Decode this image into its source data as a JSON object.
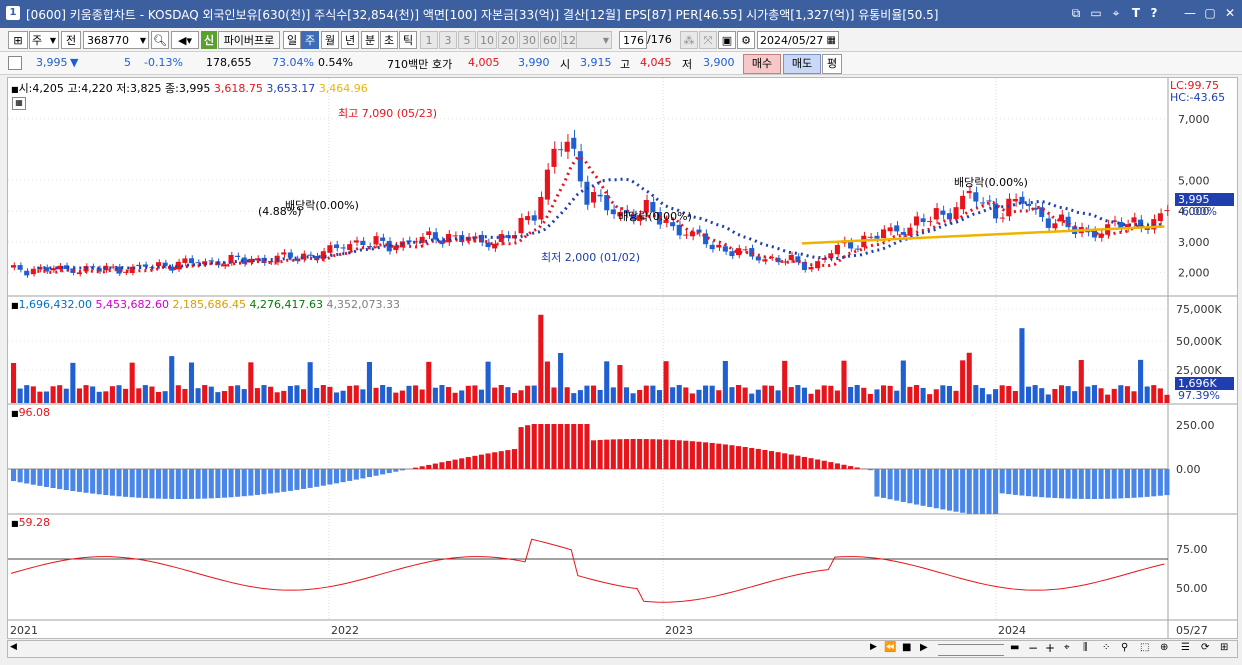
{
  "title_bar": {
    "number": "1",
    "title": "[0600] 키움종합차트 - KOSDAQ 외국인보유[630(천)] 주식수[32,854(천)] 액면[100] 자본금[33(억)] 결산[12월] EPS[87] PER[46.55] 시가총액[1,327(억)] 유통비율[50.5]",
    "controls": [
      "⧉",
      "▭",
      "⌖",
      "T",
      "?",
      "│",
      "—",
      "▢",
      "✕"
    ]
  },
  "toolbar": {
    "period_type": "주",
    "period_scope": "전",
    "stock_code": "368770",
    "indicator_badge": "신",
    "indicator_name": "파이버프로",
    "tabs": [
      "일",
      "주",
      "월",
      "년",
      "분",
      "초",
      "틱"
    ],
    "selected_tab": "주",
    "interval_buttons": [
      "1",
      "3",
      "5",
      "10",
      "20",
      "30",
      "60",
      "120"
    ],
    "count": "176",
    "count_total": "/176",
    "date": "2024/05/27"
  },
  "quote": {
    "price": "3,995",
    "change_arrow": "▼",
    "change": "5",
    "change_pct": "-0.13%",
    "volume": "178,655",
    "vol_ratio": "73.04%",
    "turnover": "0.54%",
    "amount": "710백만",
    "ask_label": "호가",
    "ask": "4,005",
    "bid": "3,990",
    "open_label": "시",
    "open": "3,915",
    "high_label": "고",
    "high": "4,045",
    "low_label": "저",
    "low": "3,900",
    "buy": "매수",
    "sell": "매도",
    "eval": "평"
  },
  "price_panel": {
    "legend_ohlc": "시:4,205 고:4,220 저:3,825 종:3,995",
    "legend_ma1": "3,618.75",
    "legend_ma2": "3,653.17",
    "legend_ma3": "3,464.96",
    "lc": "LC:99.75",
    "hc": "HC:-43.65",
    "y_ticks": [
      "7,000",
      "5,000",
      "4,000",
      "3,000",
      "2,000"
    ],
    "current_price_tag": "3,995",
    "current_pct_tag": "-6.00%",
    "ann_high": "최고 7,090 (05/23)",
    "ann_low": "최저 2,000 (01/02)",
    "ann_div1": "배당락(0.00%)",
    "ann_div1_pct": "(4.88%)",
    "ann_div2": "배당락(0.00%)",
    "ann_div3": "배당락(0.00%)"
  },
  "volume_panel": {
    "legend_values": [
      "1,696,432.00",
      "5,453,682.60",
      "2,185,686.45",
      "4,276,417.63",
      "4,352,073.33"
    ],
    "legend_colors": [
      "#0070c0",
      "#cc00cc",
      "#d4a000",
      "#008000",
      "#808080"
    ],
    "y_ticks": [
      "75,000K",
      "50,000K",
      "25,000K"
    ],
    "current_tag": "1,696K",
    "pct_tag": "97.39%"
  },
  "macd_panel": {
    "legend": "96.08",
    "y_ticks": [
      "250.00",
      "0.00"
    ]
  },
  "rsi_panel": {
    "legend": "59.28",
    "y_ticks": [
      "75.00",
      "50.00"
    ]
  },
  "x_axis": {
    "labels": [
      "2021",
      "2022",
      "2023",
      "2024"
    ],
    "end_label": "05/27"
  },
  "colors": {
    "up": "#e8141c",
    "down": "#1f5fd1",
    "title_bg": "#3c5fa0",
    "ma_yellow": "#f0b400"
  },
  "chart_data": {
    "type": "candlestick",
    "interval": "weekly",
    "date_range": [
      "2021",
      "2024/05/27"
    ],
    "price_high": {
      "value": 7090,
      "date": "05/23"
    },
    "price_low": {
      "value": 2000,
      "date": "01/02"
    },
    "last": {
      "open": 4205,
      "high": 4220,
      "low": 3825,
      "close": 3995
    },
    "price_ylim": [
      1500,
      8000
    ]
  }
}
